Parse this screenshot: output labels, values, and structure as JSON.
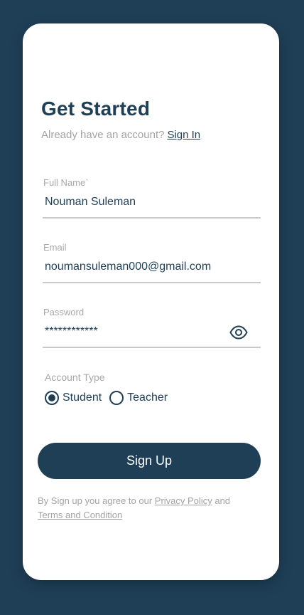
{
  "header": {
    "title": "Get Started",
    "subtitle": "Already have an account?",
    "signin_link": "Sign In"
  },
  "form": {
    "full_name": {
      "label": "Full Name`",
      "value": "Nouman Suleman"
    },
    "email": {
      "label": "Email",
      "value": "noumansuleman000@gmail.com"
    },
    "password": {
      "label": "Password",
      "value": "************",
      "toggle_icon": "eye-icon"
    },
    "account_type": {
      "label": "Account Type",
      "options": [
        "Student",
        "Teacher"
      ],
      "selected": "Student"
    }
  },
  "actions": {
    "signup_label": "Sign Up"
  },
  "terms": {
    "prefix": "By Sign up you agree to our",
    "privacy_link": "Privacy Policy",
    "and": "and",
    "terms_link": "Terms and Condition"
  },
  "colors": {
    "primary": "#1f3f57",
    "background": "#1f3f57",
    "muted": "#a3a3a3"
  }
}
